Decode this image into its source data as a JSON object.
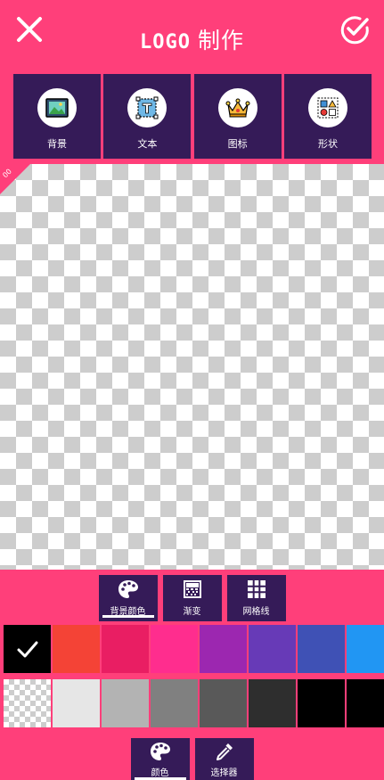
{
  "header": {
    "title_logo": "LOGO",
    "title_text": "制作"
  },
  "tools": [
    {
      "label": "背景",
      "icon": "image-icon"
    },
    {
      "label": "文本",
      "icon": "text-frame-icon"
    },
    {
      "label": "图标",
      "icon": "crown-icon"
    },
    {
      "label": "形状",
      "icon": "shapes-icon"
    }
  ],
  "canvas": {
    "corner_text": "00"
  },
  "subtabs": [
    {
      "label": "背景颜色",
      "icon": "palette-icon",
      "selected": true
    },
    {
      "label": "渐变",
      "icon": "gradient-icon",
      "selected": false
    },
    {
      "label": "网格线",
      "icon": "grid-icon",
      "selected": false
    }
  ],
  "colors": {
    "row1": [
      "#000000",
      "#f44336",
      "#e91e63",
      "#ff2d8e",
      "#9c27b0",
      "#673ab7",
      "#3f51b5",
      "#2196f3"
    ],
    "row2": [
      "transparent",
      "#e6e6e6",
      "#b3b3b3",
      "#808080",
      "#595959",
      "#2e2e2e",
      "#000000",
      "#000000"
    ],
    "selected": "#000000",
    "accent": "#ff3f7a",
    "panel": "#351b58"
  },
  "bottom_tabs": [
    {
      "label": "颜色",
      "icon": "palette-icon",
      "selected": true
    },
    {
      "label": "选择器",
      "icon": "eyedropper-icon",
      "selected": false
    }
  ]
}
